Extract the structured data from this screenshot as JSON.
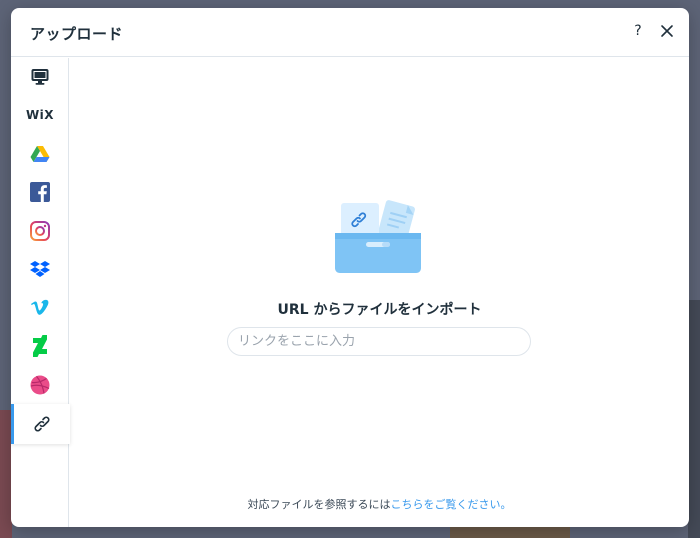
{
  "modal": {
    "title": "アップロード",
    "help_label": "?",
    "close_icon": "close-icon"
  },
  "sidebar": {
    "items": [
      {
        "name": "my-computer",
        "icon": "monitor-icon"
      },
      {
        "name": "wix",
        "icon": "wix-logo-icon",
        "label": "WiX"
      },
      {
        "name": "google-drive",
        "icon": "google-drive-icon"
      },
      {
        "name": "facebook",
        "icon": "facebook-icon"
      },
      {
        "name": "instagram",
        "icon": "instagram-icon"
      },
      {
        "name": "dropbox",
        "icon": "dropbox-icon"
      },
      {
        "name": "vimeo",
        "icon": "vimeo-icon"
      },
      {
        "name": "deviantart",
        "icon": "deviantart-icon"
      },
      {
        "name": "dribbble",
        "icon": "dribbble-icon"
      },
      {
        "name": "url-import",
        "icon": "link-icon",
        "active": true
      }
    ]
  },
  "main": {
    "heading": "URL からファイルをインポート",
    "input_placeholder": "リンクをここに入力",
    "input_value": "",
    "footer_text": "対応ファイルを参照するには",
    "footer_link": "こちらをご覧ください。"
  },
  "colors": {
    "accent": "#3899ec",
    "text": "#20303c",
    "divider": "#dfe5eb"
  }
}
